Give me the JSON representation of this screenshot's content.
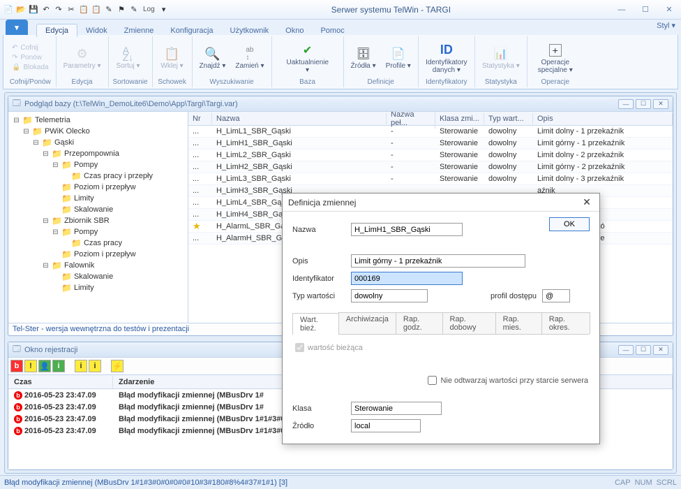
{
  "window": {
    "title": "Serwer systemu TelWin - TARGI",
    "styl_label": "Styl"
  },
  "qat": {
    "log_label": "Log"
  },
  "tabs": {
    "items": [
      "Edycja",
      "Widok",
      "Zmienne",
      "Konfiguracja",
      "Użytkownik",
      "Okno",
      "Pomoc"
    ],
    "active": 0
  },
  "ribbon": {
    "groups": [
      {
        "label": "Cofnij/Ponów",
        "items": [
          {
            "label": "Cofnij",
            "icon": "↶",
            "small": true
          },
          {
            "label": "Ponów",
            "icon": "↷",
            "small": true
          },
          {
            "label": "Blokada",
            "icon": "🔒",
            "small": true
          }
        ]
      },
      {
        "label": "Edycja",
        "items": [
          {
            "label": "Parametry",
            "icon": "param"
          }
        ]
      },
      {
        "label": "Sortowanie",
        "items": [
          {
            "label": "Sortuj",
            "icon": "AZ"
          }
        ]
      },
      {
        "label": "Schowek",
        "items": [
          {
            "label": "Wklej",
            "icon": "paste"
          }
        ]
      },
      {
        "label": "Wyszukiwanie",
        "items": [
          {
            "label": "Znajdź",
            "icon": "find"
          },
          {
            "label": "Zamień",
            "icon": "abc",
            "small_stack": true
          }
        ]
      },
      {
        "label": "Baza",
        "items": [
          {
            "label": "Uaktualnienie",
            "icon": "✔",
            "green": true,
            "wide": true
          }
        ]
      },
      {
        "label": "Definicje",
        "items": [
          {
            "label": "Źródła",
            "icon": "src"
          },
          {
            "label": "Profile",
            "icon": "prof"
          }
        ]
      },
      {
        "label": "Identyfikatory",
        "items": [
          {
            "label": "Identyfikatory danych",
            "icon": "ID",
            "blue": true
          }
        ]
      },
      {
        "label": "Statystyka",
        "items": [
          {
            "label": "Statystyka",
            "icon": "chart"
          }
        ]
      },
      {
        "label": "Operacje",
        "items": [
          {
            "label": "Operacje specjalne",
            "icon": "+"
          }
        ]
      }
    ]
  },
  "dbwindow": {
    "title": "Podgląd bazy (t:\\TelWin_DemoLite6\\Demo\\App\\Targi\\Targi.var)",
    "status": "Tel-Ster - wersja wewnętrzna do testów i prezentacji",
    "tree": [
      {
        "d": 0,
        "exp": "-",
        "label": "Telemetria"
      },
      {
        "d": 1,
        "exp": "-",
        "label": "PWiK Olecko"
      },
      {
        "d": 2,
        "exp": "-",
        "label": "Gąski"
      },
      {
        "d": 3,
        "exp": "-",
        "label": "Przepompownia"
      },
      {
        "d": 4,
        "exp": "-",
        "label": "Pompy"
      },
      {
        "d": 5,
        "exp": "",
        "label": "Czas pracy i przepły"
      },
      {
        "d": 4,
        "exp": "",
        "label": "Poziom i przepływ"
      },
      {
        "d": 4,
        "exp": "",
        "label": "Limity"
      },
      {
        "d": 4,
        "exp": "",
        "label": "Skalowanie"
      },
      {
        "d": 3,
        "exp": "-",
        "label": "Zbiornik SBR"
      },
      {
        "d": 4,
        "exp": "-",
        "label": "Pompy"
      },
      {
        "d": 5,
        "exp": "",
        "label": "Czas pracy"
      },
      {
        "d": 4,
        "exp": "",
        "label": "Poziom i przepływ"
      },
      {
        "d": 3,
        "exp": "-",
        "label": "Falownik"
      },
      {
        "d": 4,
        "exp": "",
        "label": "Skalowanie"
      },
      {
        "d": 4,
        "exp": "",
        "label": "Limity"
      }
    ],
    "columns": {
      "nr": "Nr",
      "nazwa": "Nazwa",
      "pelna": "Nazwa peł...",
      "klasa": "Klasa zmi...",
      "typ": "Typ wart...",
      "opis": "Opis"
    },
    "rows": [
      {
        "nr": "...",
        "nazwa": "H_LimL1_SBR_Gąski",
        "pelna": "-",
        "klasa": "Sterowanie",
        "typ": "dowolny",
        "opis": "Limit dolny - 1 przekaźnik"
      },
      {
        "nr": "...",
        "nazwa": "H_LimH1_SBR_Gąski",
        "pelna": "-",
        "klasa": "Sterowanie",
        "typ": "dowolny",
        "opis": "Limit górny - 1 przekaźnik"
      },
      {
        "nr": "...",
        "nazwa": "H_LimL2_SBR_Gąski",
        "pelna": "-",
        "klasa": "Sterowanie",
        "typ": "dowolny",
        "opis": "Limit dolny - 2 przekaźnik"
      },
      {
        "nr": "...",
        "nazwa": "H_LimH2_SBR_Gąski",
        "pelna": "-",
        "klasa": "Sterowanie",
        "typ": "dowolny",
        "opis": "Limit górny - 2 przekaźnik"
      },
      {
        "nr": "...",
        "nazwa": "H_LimL3_SBR_Gąski",
        "pelna": "-",
        "klasa": "Sterowanie",
        "typ": "dowolny",
        "opis": "Limit dolny - 3 przekaźnik"
      },
      {
        "nr": "...",
        "nazwa": "H_LimH3_SBR_Gąski",
        "pelna": "",
        "klasa": "",
        "typ": "",
        "opis": "aźnik"
      },
      {
        "nr": "...",
        "nazwa": "H_LimL4_SBR_Gąski",
        "pelna": "",
        "klasa": "",
        "typ": "",
        "opis": "aźnik"
      },
      {
        "nr": "...",
        "nazwa": "H_LimH4_SBR_Gąski",
        "pelna": "",
        "klasa": "",
        "typ": "",
        "opis": "aźnik"
      },
      {
        "nr": "☆",
        "nazwa": "H_AlarmL_SBR_Gąski",
        "pelna": "",
        "klasa": "",
        "typ": "",
        "opis": "Niski poziom ściekó"
      },
      {
        "nr": "...",
        "nazwa": "H_AlarmH_SBR_Gąski",
        "pelna": "",
        "klasa": "",
        "typ": "",
        "opis": "Wysoki poziom ście"
      }
    ]
  },
  "logwindow": {
    "title": "Okno rejestracji",
    "columns": {
      "czas": "Czas",
      "zdarzenie": "Zdarzenie"
    },
    "rows": [
      {
        "czas": "2016-05-23 23:47.09",
        "text": "Błąd modyfikacji zmiennej (MBusDrv 1#"
      },
      {
        "czas": "2016-05-23 23:47.09",
        "text": "Błąd modyfikacji zmiennej (MBusDrv 1#"
      },
      {
        "czas": "2016-05-23 23:47.09",
        "text": "Błąd modyfikacji zmiennej (MBusDrv 1#1#3#0#0#0#0#10#3#180#8%4#36#1#1) [3]"
      },
      {
        "czas": "2016-05-23 23:47.09",
        "text": "Błąd modyfikacji zmiennej (MBusDrv 1#1#3#0#0#0#0#10#3#180#8%4#37#1#1) [3]"
      }
    ]
  },
  "dialog": {
    "title": "Definicja zmiennej",
    "ok": "OK",
    "labels": {
      "nazwa": "Nazwa",
      "opis": "Opis",
      "identyfikator": "Identyfikator",
      "typ": "Typ wartości",
      "profil": "profil dostępu",
      "klasa": "Klasa",
      "zrodlo": "Źródło"
    },
    "values": {
      "nazwa": "H_LimH1_SBR_Gąski",
      "opis": "Limit górny - 1 przekaźnik",
      "identyfikator": "000169",
      "typ": "dowolny",
      "profil": "@",
      "klasa": "Sterowanie",
      "zrodlo": "local"
    },
    "tabs": [
      "Wart. bież.",
      "Archiwizacja",
      "Rap. godz.",
      "Rap. dobowy",
      "Rap. mies.",
      "Rap. okres."
    ],
    "active_tab": 0,
    "checkbox": "wartość bieżąca",
    "footer_check": "Nie odtwarzaj wartości przy starcie serwera"
  },
  "statusbar": {
    "text": "Błąd modyfikacji zmiennej (MBusDrv 1#1#3#0#0#0#0#10#3#180#8%4#37#1#1) [3]",
    "indicators": [
      "CAP",
      "NUM",
      "SCRL"
    ]
  }
}
